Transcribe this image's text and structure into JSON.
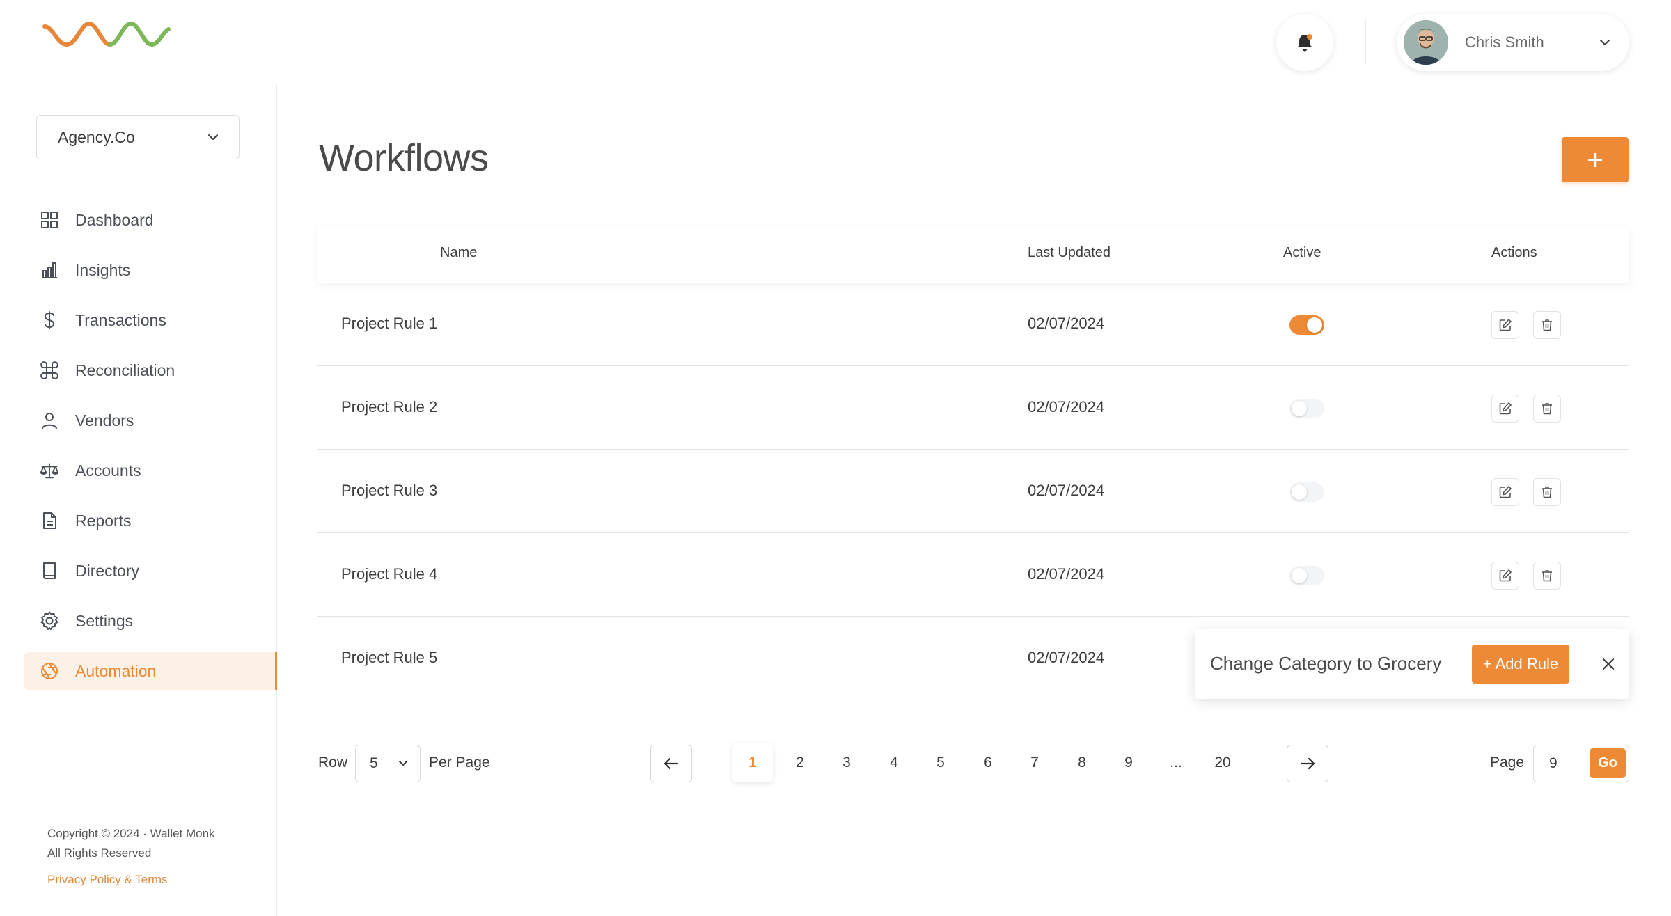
{
  "brand": {
    "logo_icon": "wave-logo-icon",
    "accent": "#ee8a35",
    "logo_orange": "#e8863a",
    "logo_green": "#7cb85a"
  },
  "header": {
    "notifications_icon": "bell-icon",
    "user": {
      "name": "Chris Smith",
      "avatar_icon": "avatar-photo",
      "menu_icon": "chevron-down-icon"
    }
  },
  "sidebar": {
    "org_select": {
      "value": "Agency.Co"
    },
    "items": [
      {
        "label": "Dashboard",
        "icon": "grid-icon"
      },
      {
        "label": "Insights",
        "icon": "bar-chart-icon"
      },
      {
        "label": "Transactions",
        "icon": "dollar-icon"
      },
      {
        "label": "Reconciliation",
        "icon": "command-icon"
      },
      {
        "label": "Vendors",
        "icon": "user-icon"
      },
      {
        "label": "Accounts",
        "icon": "scale-icon"
      },
      {
        "label": "Reports",
        "icon": "document-icon"
      },
      {
        "label": "Directory",
        "icon": "book-icon"
      },
      {
        "label": "Settings",
        "icon": "gear-icon"
      },
      {
        "label": "Automation",
        "icon": "aperture-icon",
        "active": true
      }
    ],
    "footer": {
      "copyright": "Copyright © 2024 · Wallet Monk",
      "rights": "All Rights Reserved",
      "link": "Privacy Policy & Terms"
    }
  },
  "main": {
    "title": "Workflows",
    "add_icon": "plus-icon",
    "table": {
      "columns": [
        "Name",
        "Last Updated",
        "Active",
        "Actions"
      ],
      "rows": [
        {
          "name": "Project Rule 1",
          "updated": "02/07/2024",
          "active": true
        },
        {
          "name": "Project Rule 2",
          "updated": "02/07/2024",
          "active": false
        },
        {
          "name": "Project Rule 3",
          "updated": "02/07/2024",
          "active": false
        },
        {
          "name": "Project Rule 4",
          "updated": "02/07/2024",
          "active": false
        },
        {
          "name": "Project Rule 5",
          "updated": "02/07/2024",
          "active": null
        }
      ]
    },
    "popup": {
      "text": "Change Category to Grocery",
      "button": "+ Add Rule",
      "close_icon": "close-icon"
    },
    "pagination": {
      "row_label": "Row",
      "rows_per_page": "5",
      "per_page_label": "Per Page",
      "pages": [
        "1",
        "2",
        "3",
        "4",
        "5",
        "6",
        "7",
        "8",
        "9",
        "...",
        "20"
      ],
      "current_page": "1",
      "page_label": "Page",
      "page_input": "9",
      "go_label": "Go"
    }
  }
}
